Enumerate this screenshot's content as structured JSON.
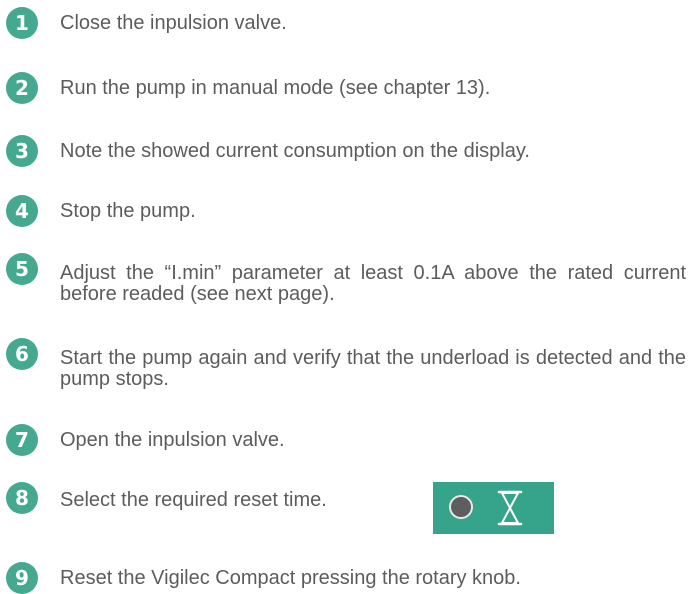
{
  "steps": [
    {
      "number": "1",
      "text": "Close the inpulsion valve."
    },
    {
      "number": "2",
      "text": "Run the pump in manual mode (see chapter 13)."
    },
    {
      "number": "3",
      "text": "Note the showed current consumption on the display."
    },
    {
      "number": "4",
      "text": "Stop the pump."
    },
    {
      "number": "5",
      "text": "Adjust the “I.min” parameter at least 0.1A above the rated current before readed (see next page)."
    },
    {
      "number": "6",
      "text": "Start the pump again and verify that the underload is detected and the pump stops."
    },
    {
      "number": "7",
      "text": "Open the inpulsion valve."
    },
    {
      "number": "8",
      "text": "Select the required reset time."
    },
    {
      "number": "9",
      "text": "Reset the Vigilec Compact pressing the rotary knob."
    }
  ],
  "colors": {
    "accent": "#44a98f",
    "panel": "#36a38b",
    "text": "#5c5c5c"
  },
  "icons": [
    "indicator-dot-icon",
    "hourglass-icon"
  ]
}
